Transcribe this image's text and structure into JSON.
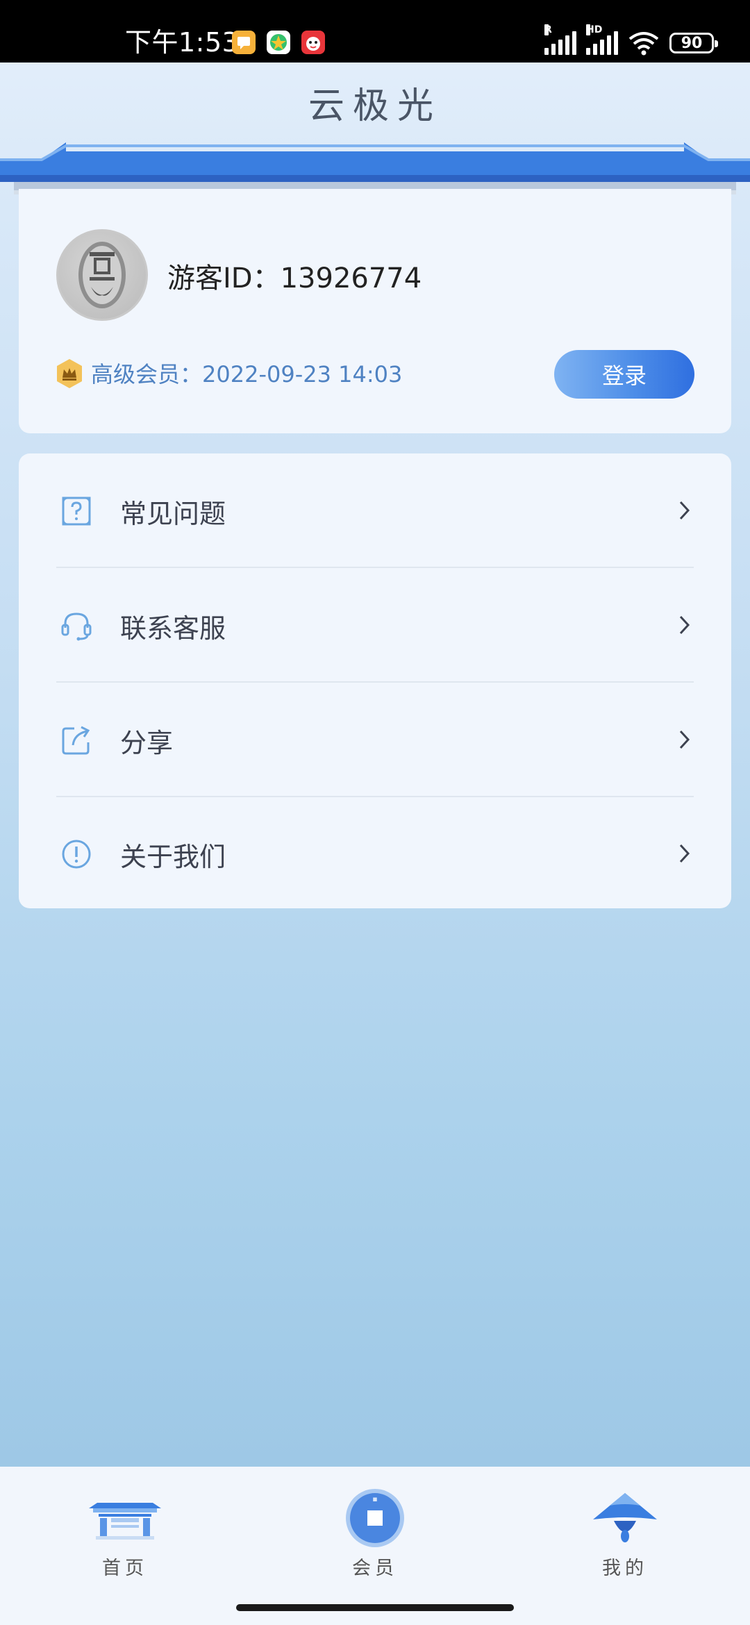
{
  "status_bar": {
    "time": "下午1:53",
    "signal1_tag": "R",
    "signal2_tag": "HD",
    "battery": "90",
    "notification_icons": [
      "message-app-icon",
      "game-app-icon",
      "shopping-app-icon"
    ]
  },
  "header": {
    "title": "云极光"
  },
  "profile": {
    "user_id": "游客ID：13926774",
    "vip_text": "高级会员：2022-09-23 14:03",
    "login_label": "登录"
  },
  "menu": {
    "items": [
      {
        "label": "常见问题",
        "icon": "question-icon"
      },
      {
        "label": "联系客服",
        "icon": "headset-icon"
      },
      {
        "label": "分享",
        "icon": "share-icon"
      },
      {
        "label": "关于我们",
        "icon": "info-icon"
      }
    ]
  },
  "bottom_nav": {
    "items": [
      {
        "label": "首页",
        "icon": "home-gate-icon"
      },
      {
        "label": "会员",
        "icon": "member-coin-icon"
      },
      {
        "label": "我的",
        "icon": "mine-hat-icon"
      }
    ],
    "active": "我的"
  },
  "colors": {
    "accent": "#2f6fe0",
    "vip_text": "#4f82c2",
    "icon_blue": "#6aa6e0"
  }
}
